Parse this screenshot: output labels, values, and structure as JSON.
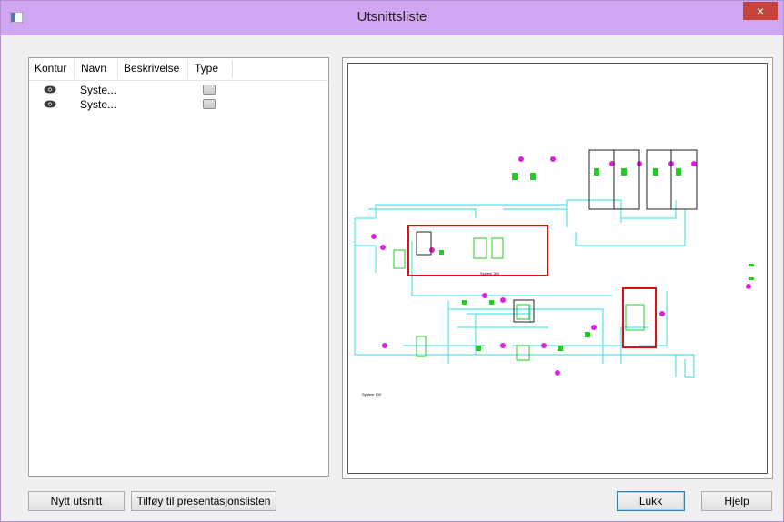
{
  "window": {
    "title": "Utsnittsliste",
    "close_glyph": "×"
  },
  "list": {
    "columns": [
      "Kontur",
      "Navn",
      "Beskrivelse",
      "Type"
    ],
    "rows": [
      {
        "icon": "eye-icon",
        "name": "Syste...",
        "type_icon": "layer-icon"
      },
      {
        "icon": "eye-icon",
        "name": "Syste...",
        "type_icon": "layer-icon"
      }
    ]
  },
  "preview": {
    "labels": [
      "System 300",
      "System 100"
    ]
  },
  "buttons": {
    "new": "Nytt utsnitt",
    "add": "Tilføy til presentasjonslisten",
    "close": "Lukk",
    "help": "Hjelp"
  },
  "colors": {
    "titlebar": "#d0a5f2",
    "close": "#c7443c",
    "pipe": "#55e6e6",
    "component": "#22cc22",
    "valve": "#e020e0",
    "highlight": "#e01010"
  }
}
